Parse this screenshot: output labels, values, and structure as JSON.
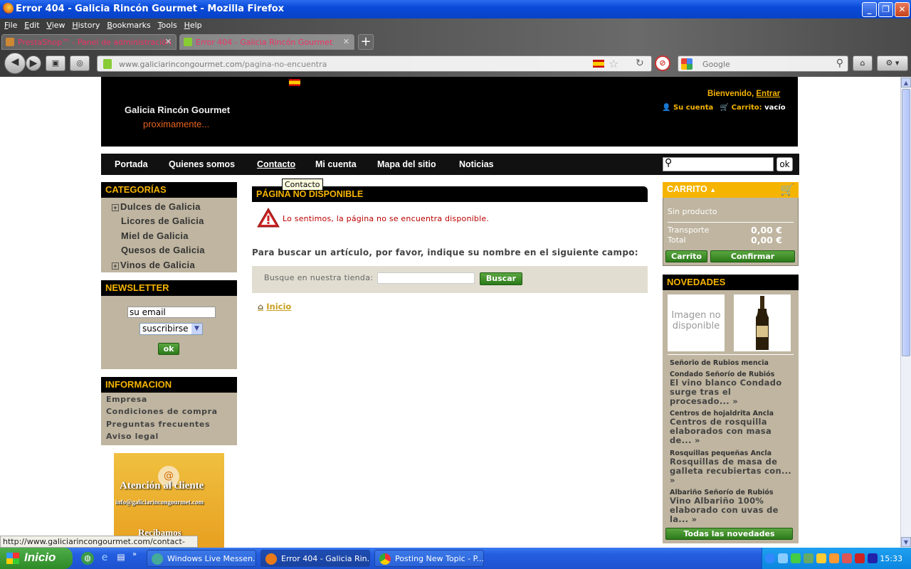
{
  "window": {
    "title": "Error 404 - Galicia Rincón Gourmet - Mozilla Firefox"
  },
  "menu": [
    "File",
    "Edit",
    "View",
    "History",
    "Bookmarks",
    "Tools",
    "Help"
  ],
  "tabs": [
    {
      "label": "PrestaShop™ - Panel de administración"
    },
    {
      "label": "Error 404 - Galicia Rincón Gourmet"
    }
  ],
  "newtab": "+",
  "url": {
    "domain": "www.galiciarincongourmet.com",
    "path": "/pagina-no-encuentra"
  },
  "search_engine_placeholder": "Google",
  "site": {
    "logo_line1": "Galicia Rincón Gourmet",
    "logo_line2": "proximamente...",
    "welcome": "Bienvenido,",
    "login": "Entrar",
    "account": "Su cuenta",
    "cart_label": "Carrito:",
    "cart_state": "vacío"
  },
  "nav": [
    "Portada",
    "Quienes somos",
    "Contacto",
    "Mi cuenta",
    "Mapa del sitio",
    "Noticias"
  ],
  "nav_search_ok": "ok",
  "tooltip": "Contacto",
  "categories": {
    "title": "CATEGORÍAS",
    "items": [
      {
        "label": "Dulces de Galicia",
        "expand": "+"
      },
      {
        "label": "Licores de Galicia",
        "expand": ""
      },
      {
        "label": "Miel de Galicia",
        "expand": ""
      },
      {
        "label": "Quesos de Galicia",
        "expand": ""
      },
      {
        "label": "Vinos de Galicia",
        "expand": "+"
      }
    ]
  },
  "newsletter": {
    "title": "NEWSLETTER",
    "email_value": "su email",
    "select": "suscribirse",
    "ok": "ok"
  },
  "informacion": {
    "title": "INFORMACION",
    "items": [
      "Empresa",
      "Condiciones de compra",
      "Preguntas frecuentes",
      "Aviso legal"
    ]
  },
  "banner": {
    "line1": "Atención al cliente",
    "line2": "info@galiciarincongourmet.com",
    "line3": "Recibamos"
  },
  "main": {
    "title": "PÁGINA NO DISPONIBLE",
    "error": "Lo sentimos, la página no se encuentra disponible.",
    "search_prompt": "Para buscar un artículo, por favor, indique su nombre en el siguiente campo:",
    "search_label": "Busque en nuestra tienda:",
    "search_button": "Buscar",
    "home_link": "Inicio"
  },
  "cart": {
    "title": "CARRITO",
    "empty": "Sin producto",
    "shipping_label": "Transporte",
    "shipping_value": "0,00 €",
    "total_label": "Total",
    "total_value": "0,00 €",
    "btn_cart": "Carrito",
    "btn_confirm": "Confirmar"
  },
  "novedades": {
    "title": "NOVEDADES",
    "no_image": "Imagen no disponible",
    "items": [
      {
        "name": "Señorio de Rubios mencia",
        "desc": ""
      },
      {
        "name": "Condado Señorío de Rubiós",
        "desc": "El vino blanco Condado surge tras el procesado..."
      },
      {
        "name": "Centros de hojaldrita Ancla",
        "desc": "Centros de rosquilla elaborados con masa de..."
      },
      {
        "name": "Rosquillas pequeñas Ancla",
        "desc": "Rosquillas de masa de galleta recubiertas con..."
      },
      {
        "name": "Albariño Señorío de Rubiós",
        "desc": "Vino Albariño 100% elaborado con uvas de la..."
      }
    ],
    "more_arrow": "»",
    "all_button": "Todas las novedades"
  },
  "statusbar": "http://www.galiciarincongourmet.com/contact-form.php",
  "taskbar": {
    "start": "Inicio",
    "items": [
      "Windows Live Messen...",
      "Error 404 - Galicia Rin...",
      "Posting New Topic - P..."
    ],
    "clock": "15:33"
  }
}
